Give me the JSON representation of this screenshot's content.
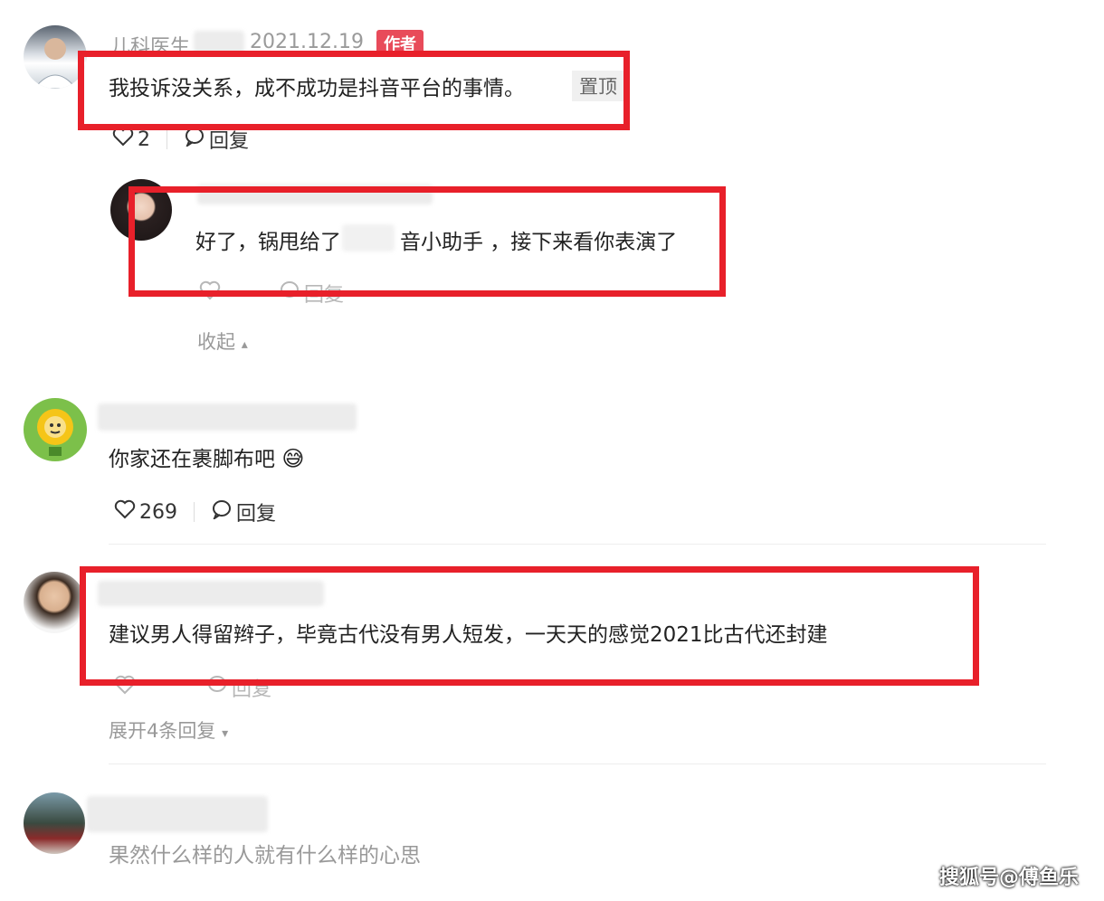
{
  "comments": [
    {
      "author": "儿科医生",
      "date": "2021.12.19",
      "badge": "作者",
      "text": "我投诉没关系，成不成功是抖音平台的事情。",
      "pin": "置顶",
      "likes": "2",
      "reply_label": "回复"
    },
    {
      "text": "你家还在裹脚布吧",
      "emoji": "😅",
      "likes": "269",
      "reply_label": "回复"
    },
    {
      "text": "建议男人得留辫子，毕竟古代没有男人短发，一天天的感觉2021比古代还封建",
      "reply_label": "回复",
      "expand_label": "展开4条回复"
    },
    {
      "text": "果然什么样的人就有什么样的心思"
    }
  ],
  "reply": {
    "text_before": "好了，锅甩给了",
    "text_after": "音小助手 ，接下来看你表演了",
    "reply_label": "回复",
    "collapse_label": "收起"
  },
  "watermark": "搜狐号@傅鱼乐",
  "colors": {
    "highlight_box": "#e8202a",
    "author_badge": "#e84b5a"
  }
}
